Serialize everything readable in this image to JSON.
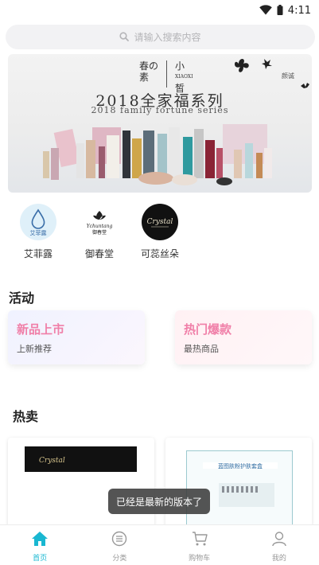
{
  "status": {
    "time": "4:11"
  },
  "search": {
    "placeholder": "请输入搜索内容"
  },
  "banner": {
    "brand_a_line1": "春の",
    "brand_a_line2": "素",
    "brand_b_line1": "小",
    "brand_b_line2": "皙",
    "brand_b_latin": "XIAOXI",
    "title": "2018全家福系列",
    "subtitle": "2018 family fortune series",
    "side_text": "颜诚"
  },
  "brands": [
    {
      "name": "艾菲露",
      "logo_text": "艾菲露",
      "color": "#dff0f9"
    },
    {
      "name": "御春堂",
      "logo_text": "御春堂",
      "color": "#ffffff"
    },
    {
      "name": "可蕊丝朵",
      "logo_text": "Crystal",
      "color": "#111111"
    }
  ],
  "activity": {
    "title": "活动",
    "cards": [
      {
        "title": "新品上市",
        "subtitle": "上新推荐",
        "title_color": "#f07fa8"
      },
      {
        "title": "热门爆款",
        "subtitle": "最热商品",
        "title_color": "#f07fa8"
      }
    ]
  },
  "hot": {
    "title": "热卖",
    "items": [
      {
        "label": "Crystal"
      },
      {
        "label": "蓝图肤粉护肤套盒"
      }
    ]
  },
  "toast": "已经是最新的版本了",
  "tabbar": {
    "active_color": "#19b7d1",
    "items": [
      {
        "label": "首页",
        "icon": "home-icon"
      },
      {
        "label": "分类",
        "icon": "category-icon"
      },
      {
        "label": "购物车",
        "icon": "cart-icon"
      },
      {
        "label": "我的",
        "icon": "profile-icon"
      }
    ]
  }
}
